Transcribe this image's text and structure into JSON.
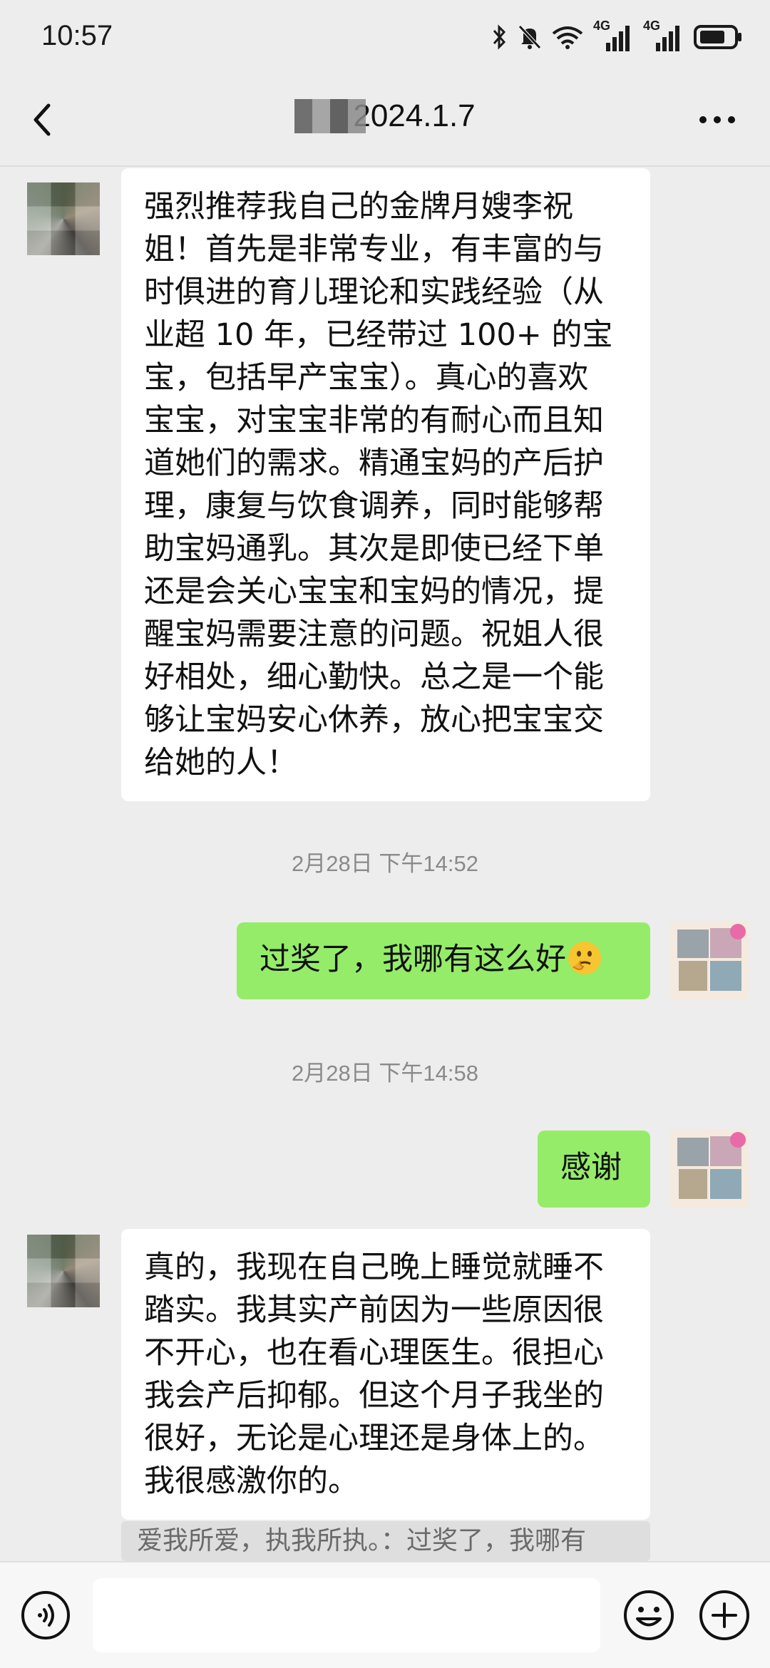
{
  "status_bar": {
    "time": "10:57",
    "net1": "4G",
    "net2": "4G"
  },
  "header": {
    "title": "2024.1.7",
    "back_icon": "chevron-left-icon",
    "more_icon": "more-dots-icon"
  },
  "messages": [
    {
      "side": "left",
      "lines": [
        "强烈推荐我自己的金牌月嫂李祝",
        "姐！首先是非常专业，有丰富的与",
        "时俱进的育儿理论和实践经验（从",
        "业超 10 年，已经带过 100+ 的宝",
        "宝，包括早产宝宝）。真心的喜欢",
        "宝宝，对宝宝非常的有耐心而且知",
        "道她们的需求。精通宝妈的产后护",
        "理，康复与饮食调养，同时能够帮",
        "助宝妈通乳。其次是即使已经下单",
        "还是会关心宝宝和宝妈的情况，提",
        "醒宝妈需要注意的问题。祝姐人很",
        "好相处，细心勤快。总之是一个能",
        "够让宝妈安心休养，放心把宝宝交",
        "给她的人！"
      ]
    },
    {
      "timestamp": "2月28日 下午14:52"
    },
    {
      "side": "right",
      "text": "过奖了，我哪有这么好",
      "emoji": "thinking-face-emoji"
    },
    {
      "timestamp": "2月28日 下午14:58"
    },
    {
      "side": "right",
      "text": "感谢"
    },
    {
      "side": "left",
      "lines": [
        "真的，我现在自己晚上睡觉就睡不",
        "踏实。我其实产前因为一些原因很",
        "不开心，也在看心理医生。很担心",
        "我会产后抑郁。但这个月子我坐的",
        "很好，无论是心理还是身体上的。",
        "我很感激你的。"
      ]
    },
    {
      "quote": "爱我所爱，执我所执。：过奖了，我哪有"
    }
  ],
  "input_bar": {
    "voice_icon": "voice-icon",
    "emoji_icon": "smiley-icon",
    "plus_icon": "plus-icon"
  },
  "colors": {
    "background": "#ededed",
    "green_bubble": "#95ec69",
    "white_bubble": "#ffffff",
    "timestamp": "#8a8a8a"
  }
}
